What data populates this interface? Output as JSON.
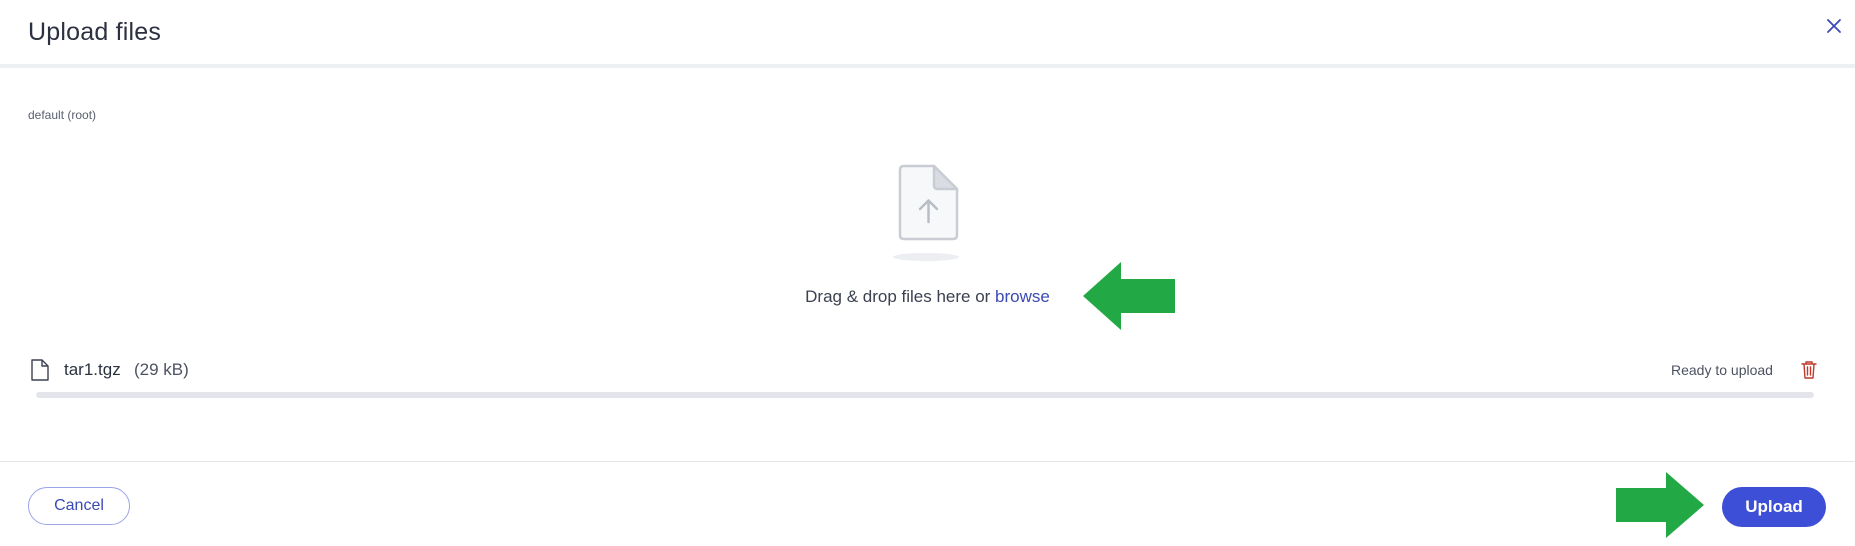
{
  "dialog": {
    "title": "Upload files",
    "path_label": "default (root)"
  },
  "dropzone": {
    "text_prefix": "Drag & drop files here or ",
    "browse_label": "browse"
  },
  "file": {
    "name": "tar1.tgz",
    "size": "(29 kB)",
    "status": "Ready to upload",
    "progress": 0
  },
  "footer": {
    "cancel_label": "Cancel",
    "upload_label": "Upload"
  },
  "colors": {
    "accent": "#3d4fd6",
    "link": "#3a4ab3",
    "danger": "#c0392b",
    "annotation_arrow": "#22a845"
  },
  "icons": [
    "close-icon",
    "file-upload-icon",
    "file-icon",
    "trash-icon",
    "arrow-left-annotation",
    "arrow-right-annotation"
  ]
}
